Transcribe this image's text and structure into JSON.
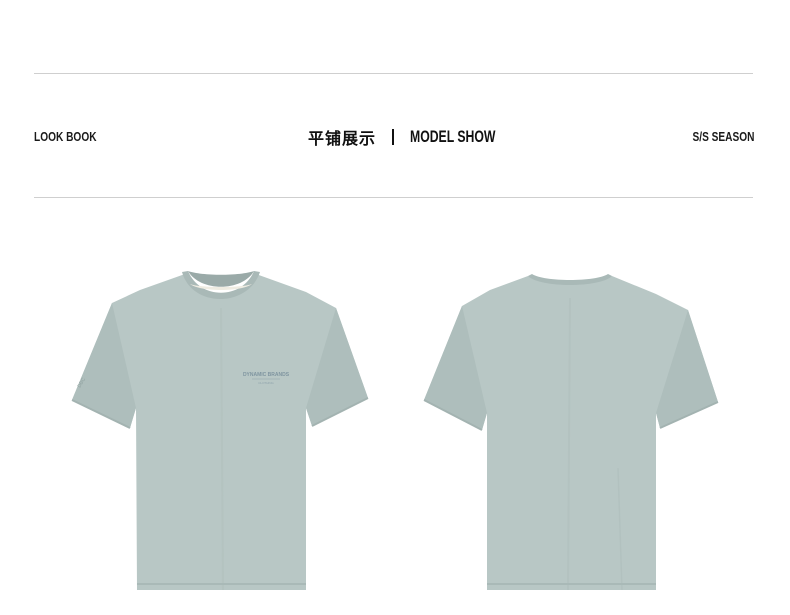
{
  "header": {
    "left_label": "LOOK BOOK",
    "center_cn": "平铺展示",
    "center_en": "MODEL SHOW",
    "right_label": "S/S SEASON"
  },
  "products": [
    {
      "view": "front",
      "chest_print_line1": "DYNAMIC BRANDS",
      "chest_print_line2": "CLOTHING"
    },
    {
      "view": "back"
    }
  ],
  "colors": {
    "shirt_body": "#b7c6c4",
    "shirt_shadow": "#a5b5b3",
    "rule": "#cfcfcf",
    "text": "#1a1a1a"
  }
}
